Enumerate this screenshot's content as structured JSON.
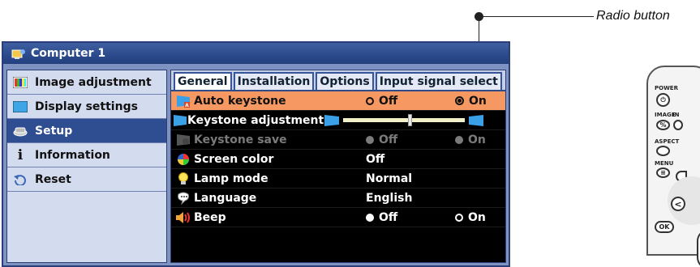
{
  "callout": {
    "text": "Radio button"
  },
  "window": {
    "title": "Computer 1"
  },
  "nav": {
    "items": [
      {
        "label": "Image adjustment",
        "icon": "image-adjustment-icon"
      },
      {
        "label": "Display settings",
        "icon": "display-settings-icon"
      },
      {
        "label": "Setup",
        "icon": "setup-icon",
        "active": true
      },
      {
        "label": "Information",
        "icon": "information-icon"
      },
      {
        "label": "Reset",
        "icon": "reset-icon"
      }
    ]
  },
  "tabs": [
    {
      "label": "General",
      "active": true
    },
    {
      "label": "Installation"
    },
    {
      "label": "Options"
    },
    {
      "label": "Input signal select"
    }
  ],
  "rows": [
    {
      "label": "Auto keystone",
      "icon": "auto-keystone-icon",
      "opt1": "Off",
      "opt2": "On",
      "selected": "On"
    },
    {
      "label": "Keystone adjustment",
      "icon": "keystone-adjustment-icon",
      "value": "0",
      "slider_fraction": 0.55
    },
    {
      "label": "Keystone save",
      "icon": "keystone-save-icon",
      "opt1": "Off",
      "opt2": "On",
      "disabled": true
    },
    {
      "label": "Screen color",
      "icon": "screen-color-icon",
      "value": "Off"
    },
    {
      "label": "Lamp mode",
      "icon": "lamp-mode-icon",
      "value": "Normal"
    },
    {
      "label": "Language",
      "icon": "language-icon",
      "value": "English"
    },
    {
      "label": "Beep",
      "icon": "beep-icon",
      "opt1": "Off",
      "opt2": "On",
      "selected": "Off"
    }
  ],
  "remote": {
    "power": "POWER",
    "image": "IMAGE",
    "in": "IN",
    "aspect": "ASPECT",
    "menu": "MENU",
    "ok": "OK",
    "percent": "%"
  },
  "colors": {
    "titlebar": "#2b4a8c",
    "selected_row": "#f59862",
    "nav_active": "#2f4e91"
  }
}
